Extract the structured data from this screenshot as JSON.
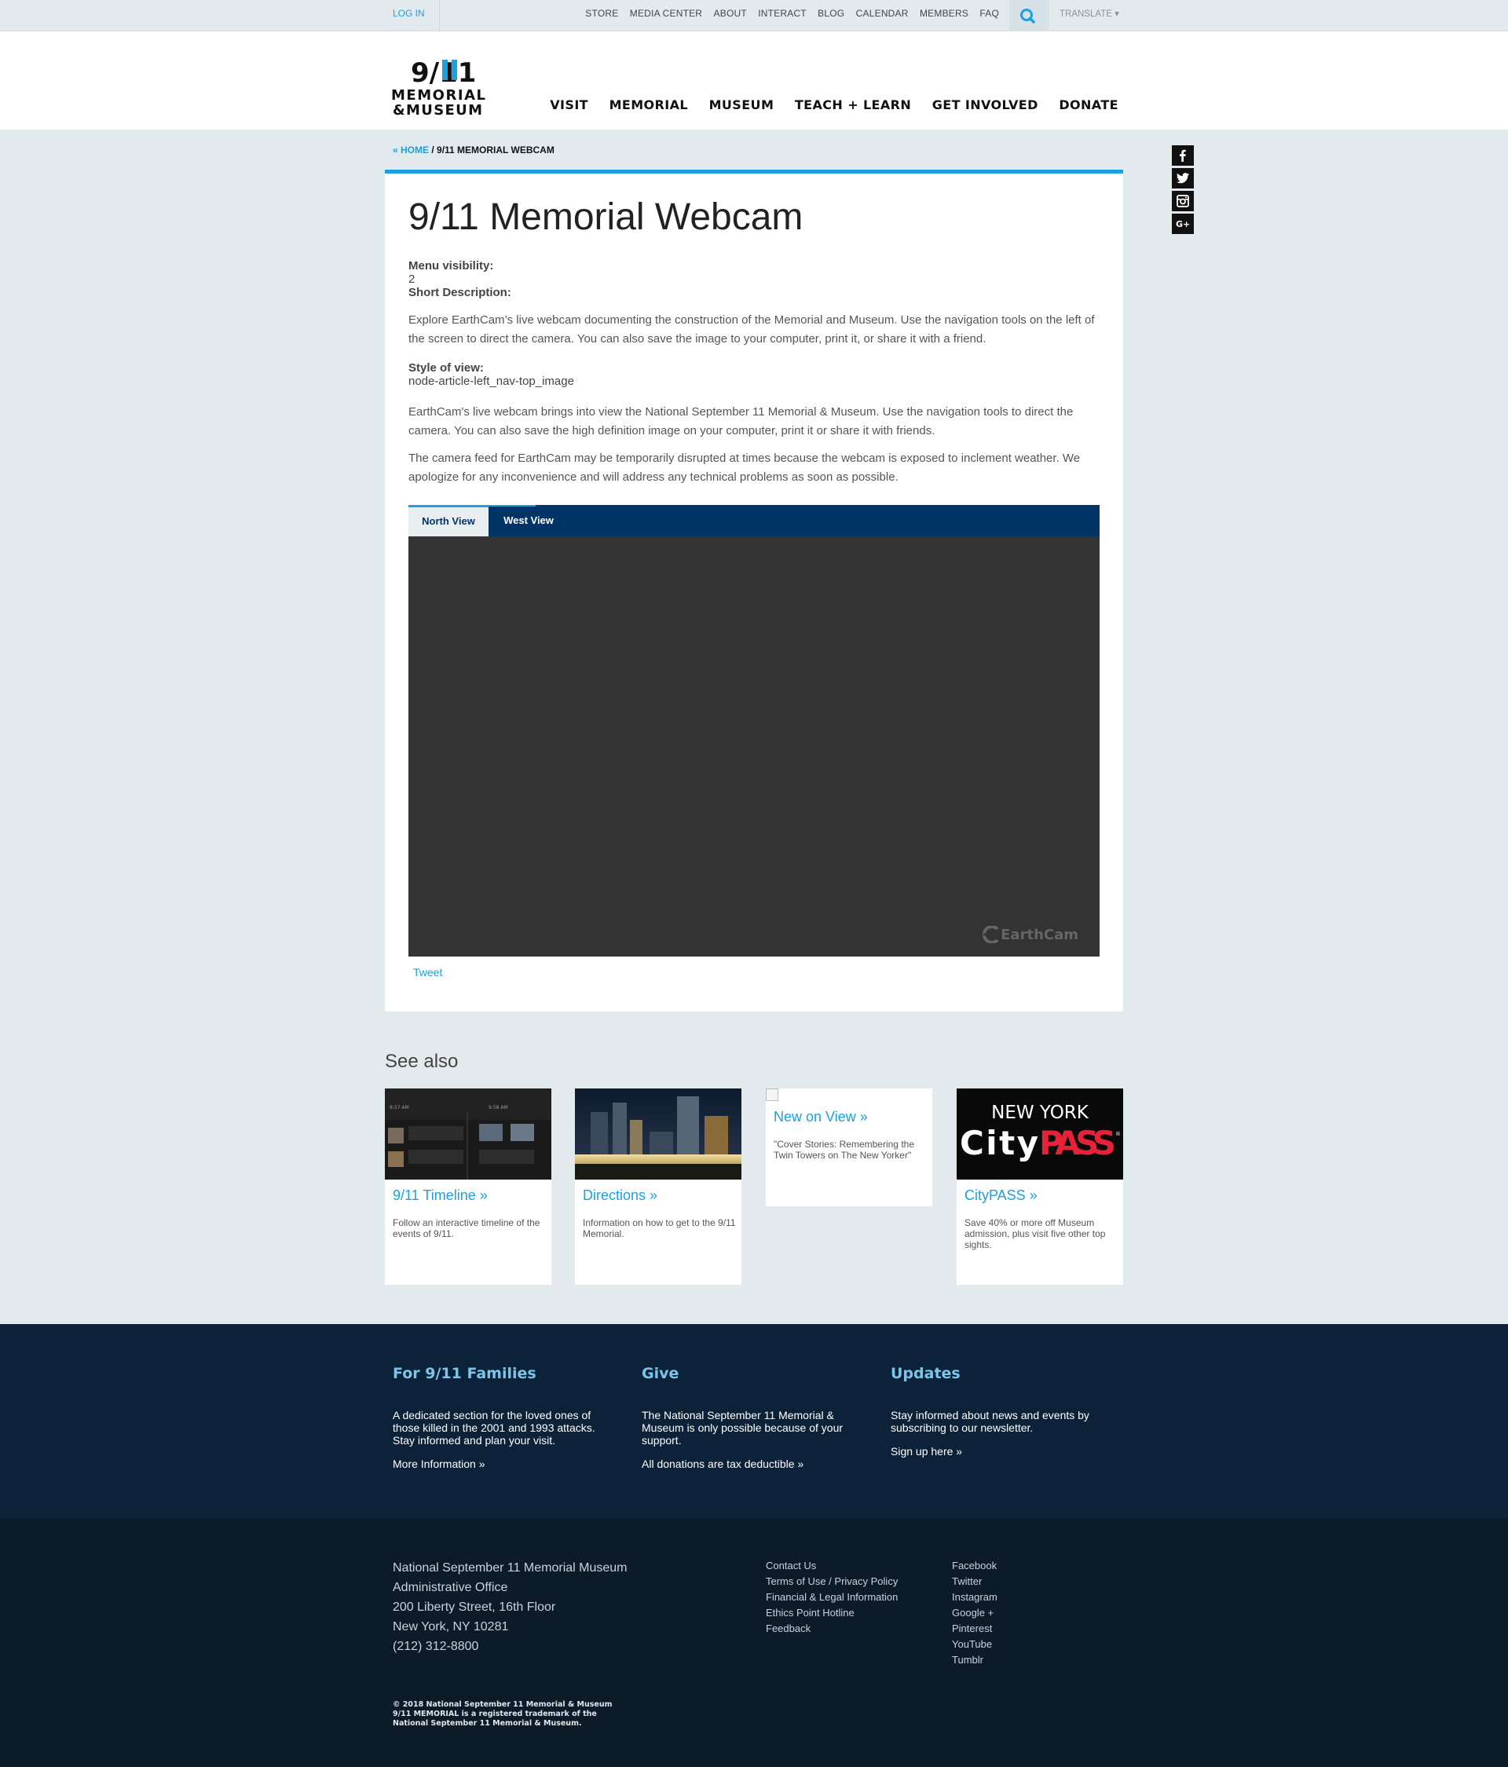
{
  "util": {
    "login": "LOG IN",
    "links": [
      "STORE",
      "MEDIA CENTER",
      "ABOUT",
      "INTERACT",
      "BLOG",
      "CALENDAR",
      "MEMBERS",
      "FAQ"
    ],
    "translate": "TRANSLATE ▾"
  },
  "header": {
    "logo_line1": "9/11",
    "logo_line2": "MEMORIAL",
    "logo_line3": "&MUSEUM",
    "nav": [
      "VISIT",
      "MEMORIAL",
      "MUSEUM",
      "TEACH + LEARN",
      "GET INVOLVED",
      "DONATE"
    ]
  },
  "breadcrumb": {
    "home": "« HOME",
    "sep": " / ",
    "current": "9/11 MEMORIAL WEBCAM"
  },
  "social": [
    "facebook-icon",
    "twitter-icon",
    "instagram-icon",
    "google-plus-icon"
  ],
  "main": {
    "title": "9/11 Memorial Webcam",
    "menu_visibility_label": "Menu visibility:",
    "menu_visibility_value": "2",
    "short_desc_label": "Short Description:",
    "short_desc": "Explore EarthCam’s live webcam documenting the construction of the Memorial and Museum. Use the navigation tools on the left of the screen to direct the camera. You can also save the image to your computer, print it, or share it with a friend.",
    "style_label": "Style of view:",
    "style_value": "node-article-left_nav-top_image",
    "para1": "EarthCam's live webcam brings into view the National September 11 Memorial & Museum. Use the navigation tools to direct the camera. You can also save the high definition image on your computer, print it or share it with friends.",
    "para2": "The camera feed for EarthCam may be temporarily disrupted at times because the webcam is exposed to inclement weather. We apologize for any inconvenience and will address any technical problems as soon as possible.",
    "tabs": [
      "North View",
      "West View"
    ],
    "watermark": "EarthCam",
    "tweet": "Tweet"
  },
  "see_also": {
    "heading": "See also",
    "tiles": [
      {
        "title": "9/11 Timeline »",
        "desc": "Follow an interactive timeline of the events of 9/11.",
        "img_text_1": "8:57 AM",
        "img_text_2": "9:58 AM"
      },
      {
        "title": "Directions »",
        "desc": "Information on how to get to the 9/11 Memorial."
      },
      {
        "title": "New on View »",
        "desc": "\"Cover Stories: Remembering the Twin Towers on The New Yorker\""
      },
      {
        "title": "CityPASS »",
        "desc": "Save 40% or more off Museum admission, plus visit five other top sights.",
        "img_line1": "NEW YORK",
        "img_city": "City",
        "img_pass": "PASS",
        "img_reg": "®"
      }
    ]
  },
  "footer_top": [
    {
      "title": "For 9/11 Families",
      "text": "A dedicated section for the loved ones of those killed in the 2001 and 1993 attacks. Stay informed and plan your visit.",
      "link": "More Information »"
    },
    {
      "title": "Give",
      "text": "The National September 11 Memorial & Museum is only possible because of your support.",
      "link": "All donations are tax deductible »"
    },
    {
      "title": "Updates",
      "text": "Stay informed about news and events by subscribing to our newsletter.",
      "link": "Sign up here »"
    }
  ],
  "footer_bottom": {
    "address": [
      "National September 11 Memorial Museum",
      "Administrative Office",
      "200 Liberty Street, 16th Floor",
      "New York, NY 10281",
      "(212) 312-8800"
    ],
    "links1": [
      "Contact Us",
      "Terms of Use / Privacy Policy",
      "Financial & Legal Information",
      "Ethics Point Hotline",
      "Feedback"
    ],
    "links2": [
      "Facebook",
      "Twitter",
      "Instagram",
      "Google +",
      "Pinterest",
      "YouTube",
      "Tumblr"
    ],
    "copyright": [
      "© 2018 National September 11 Memorial & Museum",
      "9/11 MEMORIAL is a registered trademark of the",
      "National September 11 Memorial & Museum."
    ]
  },
  "colors": {
    "accent": "#1ba1dd",
    "navy": "#003366",
    "footer_top": "#0c2238",
    "footer_bottom": "#0d1a28",
    "page_bg": "#e3eaee"
  }
}
